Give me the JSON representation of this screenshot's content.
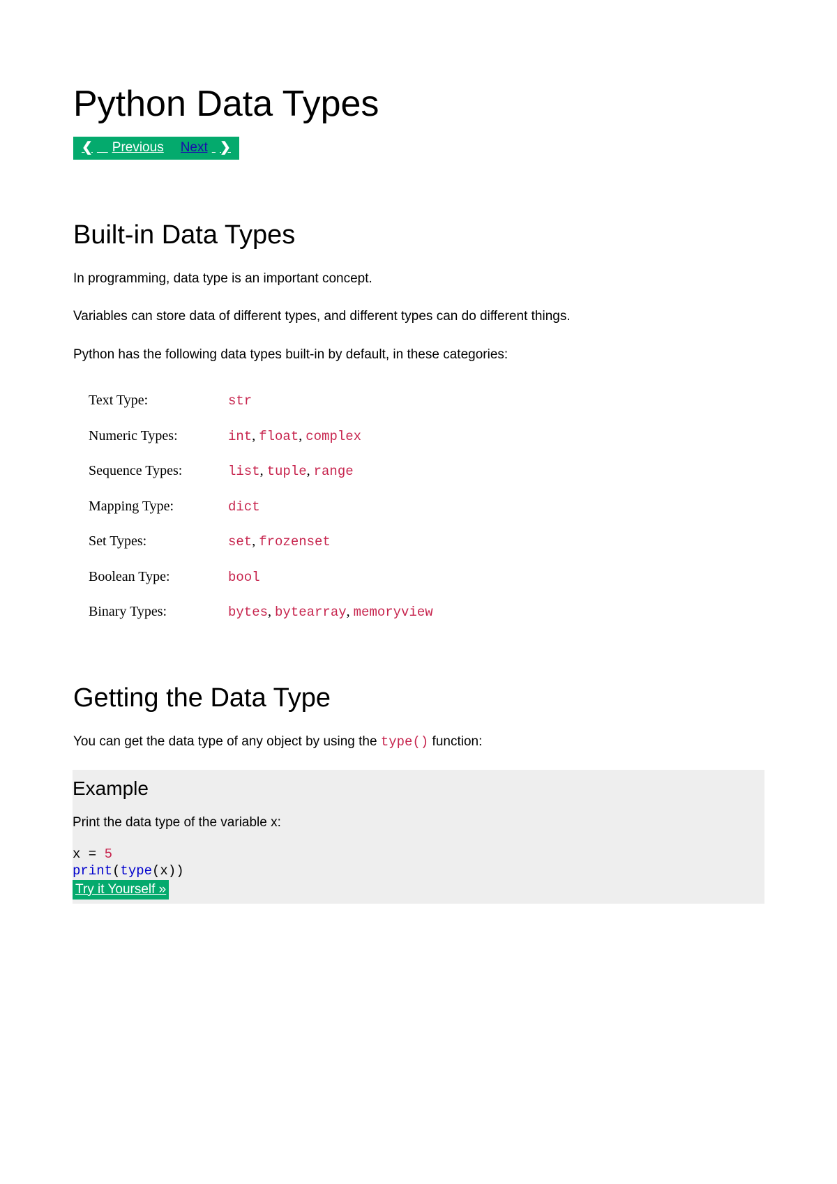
{
  "page_title": "Python Data Types",
  "nav": {
    "previous_label": "Previous",
    "next_label": "Next",
    "chevron_left": "❮",
    "chevron_right": "❯"
  },
  "section1": {
    "heading": "Built-in Data Types",
    "p1": "In programming, data type is an important concept.",
    "p2": "Variables can store data of different types, and different types can do different things.",
    "p3": "Python has the following data types built-in by default, in these categories:"
  },
  "type_rows": [
    {
      "label": "Text Type:",
      "types": [
        "str"
      ]
    },
    {
      "label": "Numeric Types:",
      "types": [
        "int",
        "float",
        "complex"
      ]
    },
    {
      "label": "Sequence Types:",
      "types": [
        "list",
        "tuple",
        "range"
      ]
    },
    {
      "label": "Mapping Type:",
      "types": [
        "dict"
      ]
    },
    {
      "label": "Set Types:",
      "types": [
        "set",
        "frozenset"
      ]
    },
    {
      "label": "Boolean Type:",
      "types": [
        "bool"
      ]
    },
    {
      "label": "Binary Types:",
      "types": [
        "bytes",
        "bytearray",
        "memoryview"
      ]
    }
  ],
  "section2": {
    "heading": "Getting the Data Type",
    "p1_before": "You can get the data type of any object by using the ",
    "p1_code": "type()",
    "p1_after": " function:"
  },
  "example": {
    "heading": "Example",
    "desc": "Print the data type of the variable x:",
    "code": {
      "line1_var": "x = ",
      "line1_val": "5",
      "line2_print": "print",
      "line2_open": "(",
      "line2_type": "type",
      "line2_inner": "(x))"
    },
    "try_label": "Try it Yourself »"
  }
}
